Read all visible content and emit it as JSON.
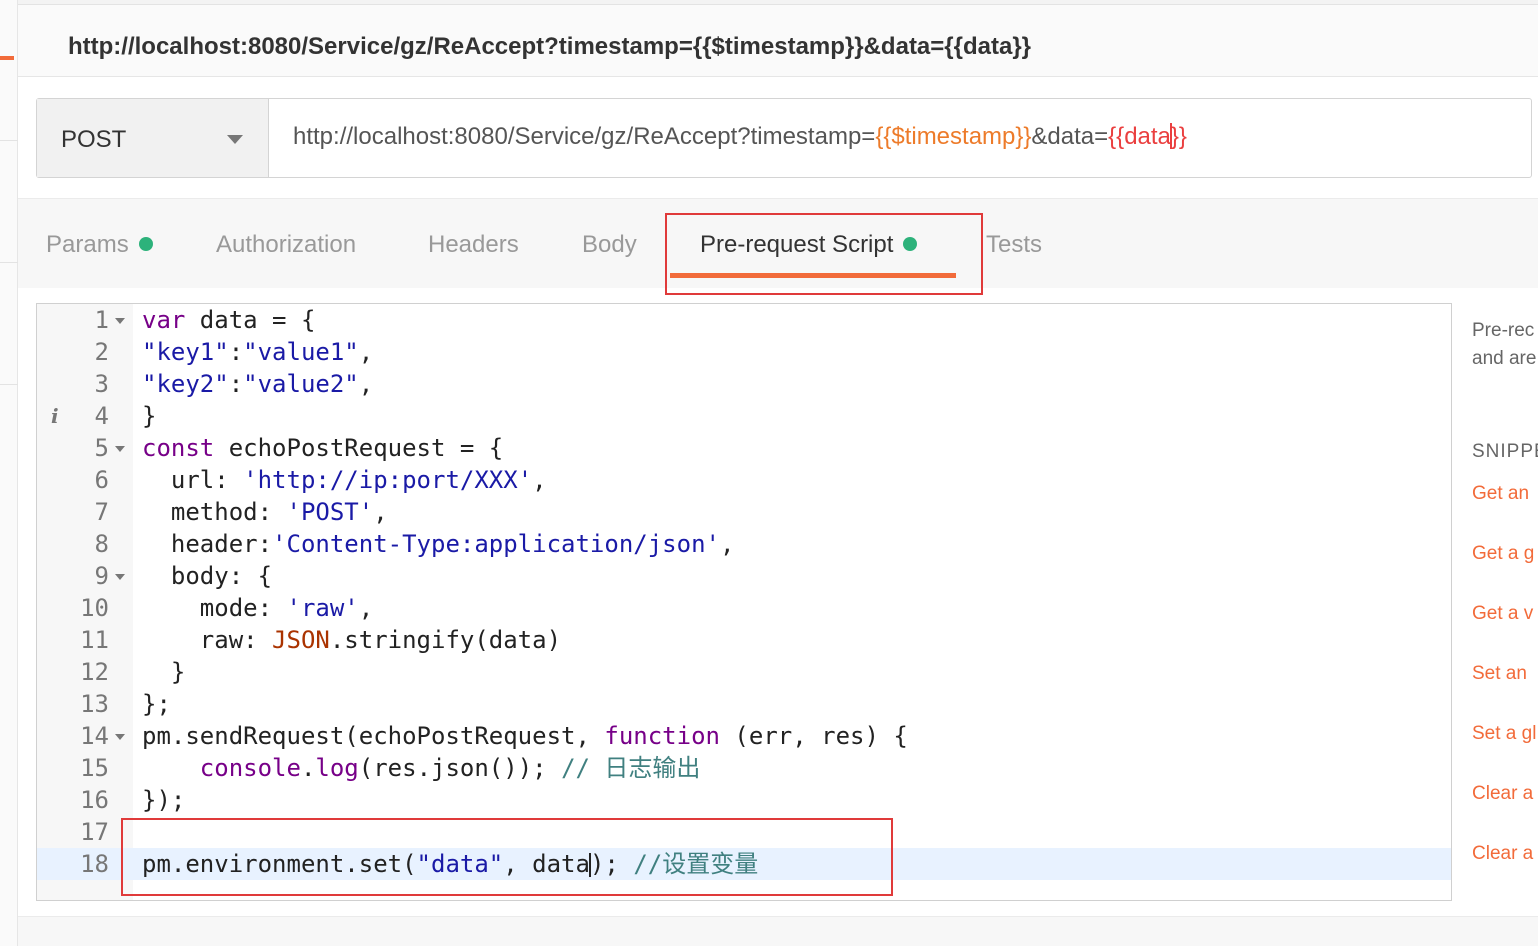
{
  "request": {
    "title": "http://localhost:8080/Service/gz/ReAccept?timestamp={{$timestamp}}&data={{data}}",
    "method": "POST",
    "url_base": "http://localhost:8080/Service/gz/ReAccept?timestamp=",
    "url_var_timestamp": "{{$timestamp}}",
    "url_mid": "&data=",
    "url_var_data_a": "{{data",
    "url_var_data_b": "}}"
  },
  "tabs": [
    {
      "label": "Params",
      "has_dot": true
    },
    {
      "label": "Authorization",
      "has_dot": false
    },
    {
      "label": "Headers",
      "has_dot": false
    },
    {
      "label": "Body",
      "has_dot": false
    },
    {
      "label": "Pre-request Script",
      "has_dot": true,
      "active": true
    },
    {
      "label": "Tests",
      "has_dot": false
    }
  ],
  "code": {
    "line_numbers": [
      "1",
      "2",
      "3",
      "4",
      "5",
      "6",
      "7",
      "8",
      "9",
      "10",
      "11",
      "12",
      "13",
      "14",
      "15",
      "16",
      "17",
      "18"
    ],
    "l1": {
      "kw": "var",
      "rest": " data = {"
    },
    "l2": {
      "s1": "\"key1\"",
      "sep": ":",
      "s2": "\"value1\"",
      "end": ","
    },
    "l3": {
      "s1": "\"key2\"",
      "sep": ":",
      "s2": "\"value2\"",
      "end": ","
    },
    "l4": {
      "text": "}"
    },
    "l5": {
      "kw": "const",
      "rest": " echoPostRequest = {"
    },
    "l6": {
      "pre": "  url: ",
      "str": "'http://ip:port/XXX'",
      "end": ","
    },
    "l7": {
      "pre": "  method: ",
      "str": "'POST'",
      "end": ","
    },
    "l8": {
      "pre": "  header:",
      "str": "'Content-Type:application/json'",
      "end": ","
    },
    "l9": {
      "text": "  body: {"
    },
    "l10": {
      "pre": "    mode: ",
      "str": "'raw'",
      "end": ","
    },
    "l11": {
      "pre": "    raw: ",
      "obj": "JSON",
      "end": ".stringify(data)"
    },
    "l12": {
      "text": "  }"
    },
    "l13": {
      "text": "};"
    },
    "l14": {
      "pre": "pm.sendRequest(echoPostRequest, ",
      "kw": "function",
      "end": " (err, res) {"
    },
    "l15": {
      "pre": "    ",
      "obj": "console",
      "mid": ".",
      "fn": "log",
      "end": "(res.json()); ",
      "cm": "// 日志输出"
    },
    "l16": {
      "text": "});"
    },
    "l17": {
      "text": ""
    },
    "l18": {
      "pre": "pm.environment.set(",
      "str": "\"data\"",
      "mid": ", data",
      "end": "); ",
      "cm": "//设置变量"
    }
  },
  "sidebar": {
    "desc_line1": "Pre-rec",
    "desc_line2": "and are",
    "snippets_heading": "SNIPPE",
    "snippets": [
      "Get an",
      "Get a g",
      "Get a v",
      "Set an",
      "Set a gl",
      "Clear a",
      "Clear a"
    ]
  },
  "colors": {
    "accent": "#f26b3a",
    "dot": "#2db27b",
    "highlight_box": "#e03a3a",
    "var_timestamp": "#ed7b2a",
    "var_data": "#ea3f3f"
  }
}
